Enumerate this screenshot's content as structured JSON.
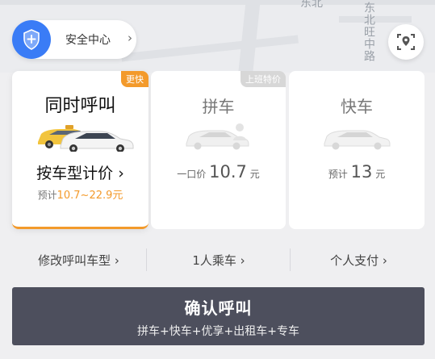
{
  "map": {
    "road_label_top": "东北",
    "road_label_vertical": "东北旺中路"
  },
  "safety": {
    "label": "安全中心",
    "chevron": "›"
  },
  "cards": [
    {
      "badge": "更快",
      "title": "同时呼叫",
      "price_type": "按车型计价 ›",
      "estimate_prefix": "预计",
      "estimate_value": "10.7~22.9元"
    },
    {
      "badge": "上班特价",
      "title": "拼车",
      "price_prefix": "一口价",
      "price_value": "10.7",
      "price_unit": "元"
    },
    {
      "title": "快车",
      "price_prefix": "预计",
      "price_value": "13",
      "price_unit": "元"
    }
  ],
  "options": [
    {
      "label": "修改呼叫车型 ›"
    },
    {
      "label": "1人乘车 ›"
    },
    {
      "label": "个人支付 ›"
    }
  ],
  "confirm": {
    "title": "确认呼叫",
    "subtitle": "拼车+快车+优享+出租车+专车"
  },
  "colors": {
    "accent": "#f39a2b",
    "primary_blue": "#3a7cf6",
    "confirm_bg": "#4d4f5d"
  }
}
